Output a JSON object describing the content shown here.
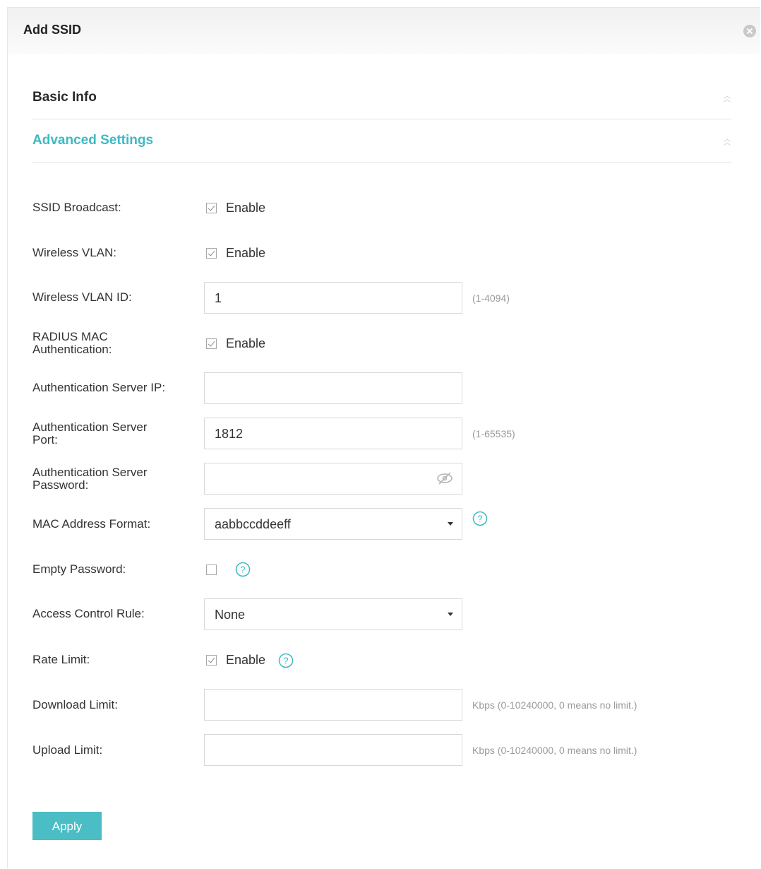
{
  "dialog": {
    "title": "Add SSID",
    "close_icon": "close-circle-icon"
  },
  "sections": {
    "basic_info": "Basic Info",
    "advanced_settings": "Advanced Settings",
    "advanced_color": "#3fb9c2"
  },
  "fields": {
    "ssid_broadcast": {
      "label": "SSID Broadcast:",
      "option": "Enable",
      "checked": true
    },
    "wireless_vlan": {
      "label": "Wireless VLAN:",
      "option": "Enable",
      "checked": true
    },
    "wireless_vlan_id": {
      "label": "Wireless VLAN ID:",
      "value": "1",
      "hint": "(1-4094)"
    },
    "radius_mac_auth": {
      "label_line1": "RADIUS MAC",
      "label_line2": "Authentication:",
      "option": "Enable",
      "checked": true
    },
    "auth_server_ip": {
      "label": "Authentication Server IP:",
      "value": ""
    },
    "auth_server_port": {
      "label_line1": "Authentication Server",
      "label_line2": "Port:",
      "value": "1812",
      "hint": "(1-65535)"
    },
    "auth_server_password": {
      "label_line1": "Authentication Server",
      "label_line2": "Password:",
      "value": "",
      "icon": "eye-off-icon"
    },
    "mac_address_format": {
      "label": "MAC Address Format:",
      "selected": "aabbccddeeff"
    },
    "empty_password": {
      "label": "Empty Password:",
      "checked": false
    },
    "access_control_rule": {
      "label": "Access Control Rule:",
      "selected": "None"
    },
    "rate_limit": {
      "label": "Rate Limit:",
      "option": "Enable",
      "checked": true
    },
    "download_limit": {
      "label": "Download Limit:",
      "value": "",
      "hint": "Kbps (0-10240000, 0 means no limit.)"
    },
    "upload_limit": {
      "label": "Upload Limit:",
      "value": "",
      "hint": "Kbps (0-10240000, 0 means no limit.)"
    }
  },
  "actions": {
    "apply": "Apply",
    "apply_color": "#4bbdc4"
  },
  "icons": {
    "help": "help-circle-icon",
    "collapse": "double-chevron-icon"
  }
}
